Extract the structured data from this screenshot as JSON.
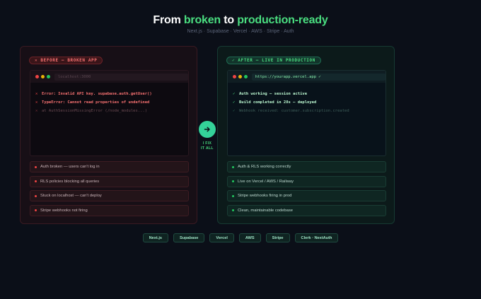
{
  "hero": {
    "title_pre": "From ",
    "title_broken": "broken",
    "title_mid": " to ",
    "title_ready": "production-ready",
    "subtitle": "Next.js · Supabase · Vercel · AWS · Stripe · Auth"
  },
  "before": {
    "tag": "✕ BEFORE — BROKEN APP",
    "url": "localhost:3000",
    "lines": [
      {
        "mark": "✕",
        "text": "Error: Invalid API key. supabase.auth.getUser()"
      },
      {
        "mark": "✕",
        "text": "TypeError: Cannot read properties of undefined"
      },
      {
        "mark": "✕",
        "text": "at AuthSessionMissingError (/node_modules...)"
      }
    ],
    "items": [
      "Auth broken — users can't log in",
      "RLS policies blocking all queries",
      "Stuck on localhost — can't deploy",
      "Stripe webhooks not firing"
    ]
  },
  "after": {
    "tag": "✓ AFTER — LIVE IN PRODUCTION",
    "url": "https://yourapp.vercel.app ✓",
    "lines": [
      {
        "mark": "✓",
        "text": "Auth working — session active"
      },
      {
        "mark": "✓",
        "text": "Build completed in 28s — deployed"
      },
      {
        "mark": "✓",
        "text": "Webhook received: customer.subscription.created"
      }
    ],
    "items": [
      "Auth & RLS working correctly",
      "Live on Vercel / AWS / Railway",
      "Stripe webhooks firing in prod",
      "Clean, maintainable codebase"
    ]
  },
  "fix": {
    "line1": "I FIX",
    "line2": "IT ALL",
    "icon": "arrow-right-icon"
  },
  "stack": [
    "Next.js",
    "Supabase",
    "Vercel",
    "AWS",
    "Stripe",
    "Clerk · NextAuth"
  ],
  "colors": {
    "accent": "#4ade80",
    "error": "#ef4444",
    "background": "#0b0f18"
  }
}
